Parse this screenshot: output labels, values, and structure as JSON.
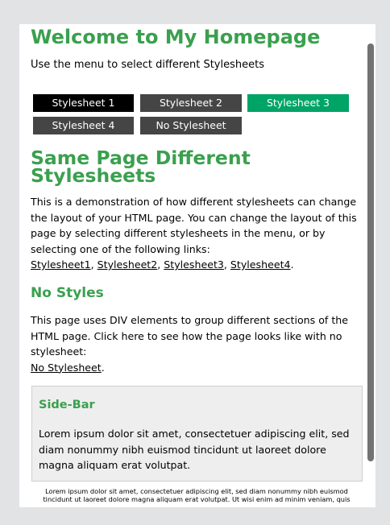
{
  "header": {
    "title": "Welcome to My Homepage",
    "subtitle": "Use the menu to select different Stylesheets"
  },
  "menu": {
    "items": [
      {
        "label": "Stylesheet 1"
      },
      {
        "label": "Stylesheet 2"
      },
      {
        "label": "Stylesheet 3"
      },
      {
        "label": "Stylesheet 4"
      },
      {
        "label": "No Stylesheet"
      }
    ]
  },
  "section1": {
    "heading": "Same Page Different Stylesheets",
    "text": "This is a demonstration of how different stylesheets can change the layout of your HTML page. You can change the layout of this page by selecting different stylesheets in the menu, or by selecting one of the following links:",
    "links": [
      "Stylesheet1",
      "Stylesheet2",
      "Stylesheet3",
      "Stylesheet4"
    ],
    "separator": ", ",
    "end": "."
  },
  "section2": {
    "heading": "No Styles",
    "text": "This page uses DIV elements to group different sections of the HTML page. Click here to see how the page looks like with no stylesheet:",
    "link": "No Stylesheet",
    "end": "."
  },
  "sidebar": {
    "title": "Side-Bar",
    "text": "Lorem ipsum dolor sit amet, consectetuer adipiscing elit, sed diam nonummy nibh euismod tincidunt ut laoreet dolore magna aliquam erat volutpat."
  },
  "footer": {
    "text": "Lorem ipsum dolor sit amet, consectetuer adipiscing elit, sed diam nonummy nibh euismod tincidunt ut laoreet dolore magna aliquam erat volutpat. Ut wisi enim ad minim veniam, quis"
  },
  "colors": {
    "heading": "#3aa04e",
    "menu_active": "#00a466",
    "menu_default": "#454545",
    "menu_first": "#000000",
    "sidebar_bg": "#eeeeee",
    "page_bg": "#e2e3e5"
  }
}
